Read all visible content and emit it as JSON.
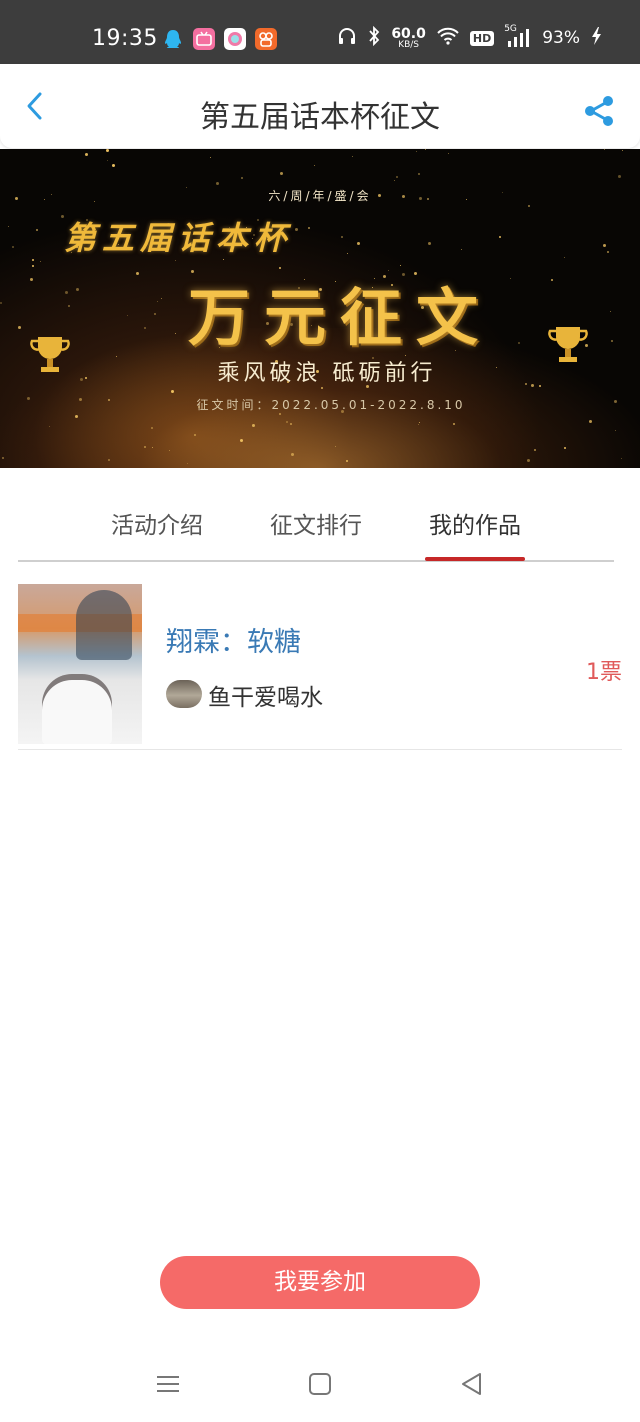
{
  "status_bar": {
    "time": "19:35",
    "net_speed_value": "60.0",
    "net_speed_unit": "KB/S",
    "hd_label": "HD",
    "signal_label": "5G",
    "battery": "93%",
    "icons": [
      "qq-icon",
      "bilibili-icon",
      "circle-app-icon",
      "orange-app-icon",
      "headphones-icon",
      "bluetooth-icon",
      "wifi-icon",
      "signal-icon",
      "charging-icon"
    ]
  },
  "header": {
    "title": "第五届话本杯征文",
    "back_icon": "chevron-left-icon",
    "share_icon": "share-icon",
    "accent_color": "#2d9be0"
  },
  "banner": {
    "sub_top": "六/周/年/盛/会",
    "edition": "第五届话本杯",
    "main_title": "万元征文",
    "slogan": "乘风破浪 砥砺前行",
    "date": "征文时间：2022.05.01-2022.8.10"
  },
  "tabs": {
    "items": [
      "活动介绍",
      "征文排行",
      "我的作品"
    ],
    "active_index": 2,
    "active_color": "#c62828"
  },
  "works": [
    {
      "title": "翔霖：软糖",
      "author": "鱼干爱喝水",
      "votes": "1票"
    }
  ],
  "join_button": {
    "label": "我要参加",
    "color": "#f56a68"
  },
  "nav_bar": {
    "icons": [
      "menu-icon",
      "home-square-icon",
      "back-triangle-icon"
    ]
  }
}
